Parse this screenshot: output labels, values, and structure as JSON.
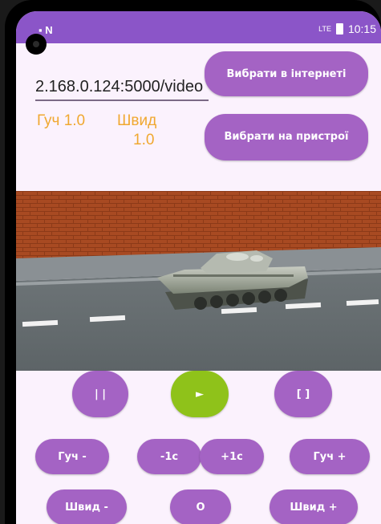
{
  "status_bar": {
    "left_icons": "▪ N",
    "signal": "LTE",
    "time": "10:15"
  },
  "url_input": {
    "value": "2.168.0.124:5000/video"
  },
  "buttons": {
    "pick_online": "Вибрати в інтернеті",
    "pick_device": "Вибрати на пристрої",
    "pause": "| |",
    "play": "►",
    "stop": "[ ]",
    "volume_down": "Гуч -",
    "rewind": "-1с",
    "forward": "+1с",
    "volume_up": "Гуч +",
    "speed_down": "Швид -",
    "speed_reset": "O",
    "speed_up": "Швид +"
  },
  "status": {
    "volume": "Гуч 1.0",
    "speed_label": "Швид",
    "speed_value": "1.0"
  },
  "colors": {
    "accent": "#a463c4",
    "play": "#8fc21a",
    "stat_text": "#f0a830",
    "status_bar": "#8b55c8"
  }
}
